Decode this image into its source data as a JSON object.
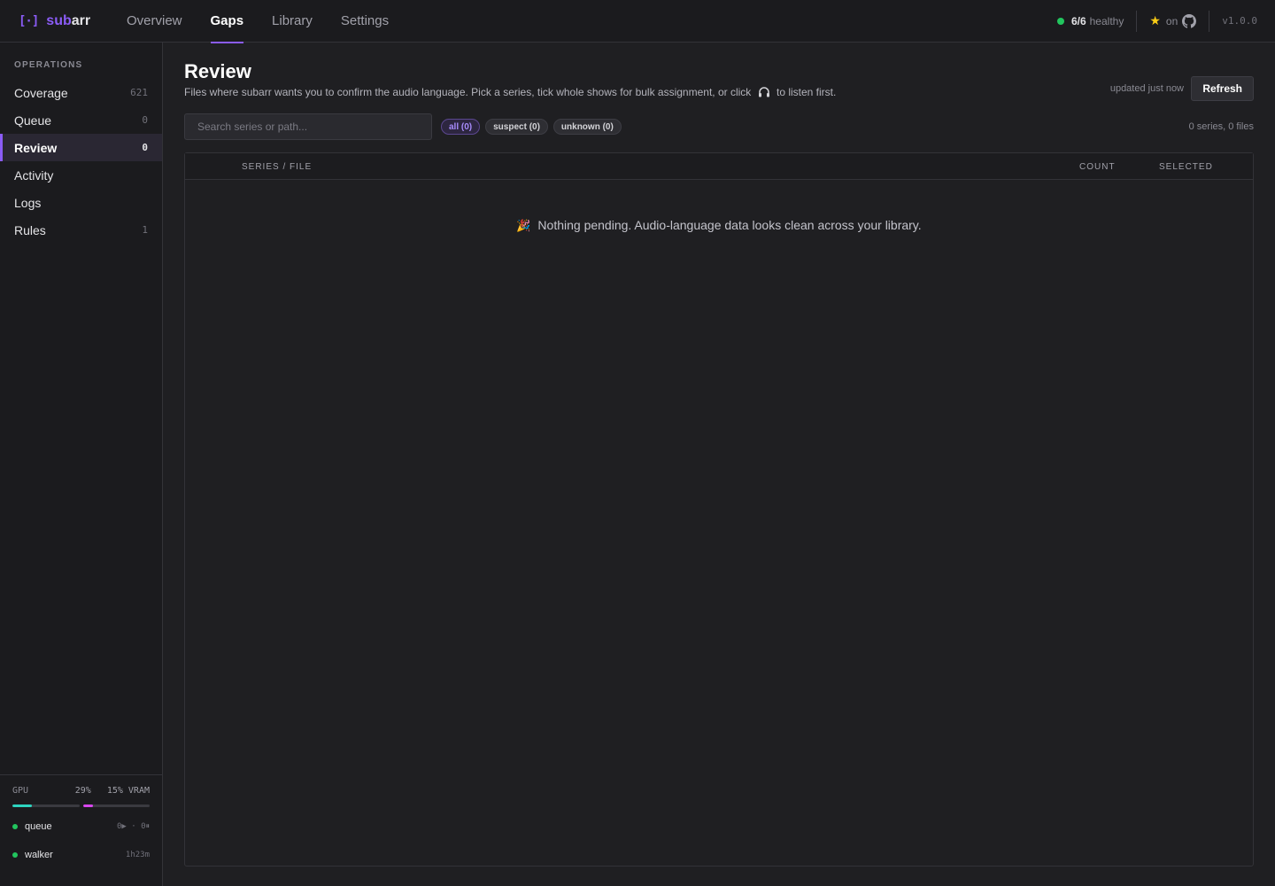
{
  "brand": {
    "icon": "[·]",
    "name_part1": "sub",
    "name_part2": "arr"
  },
  "nav": {
    "tabs": [
      {
        "label": "Overview"
      },
      {
        "label": "Gaps"
      },
      {
        "label": "Library"
      },
      {
        "label": "Settings"
      }
    ],
    "active": "Gaps"
  },
  "status": {
    "health_count": "6/6",
    "health_label": "healthy",
    "github_label": "on",
    "version": "v1.0.0",
    "health_color": "#22c55e"
  },
  "sidebar": {
    "heading": "OPERATIONS",
    "items": [
      {
        "label": "Coverage",
        "count": "621"
      },
      {
        "label": "Queue",
        "count": "0"
      },
      {
        "label": "Review",
        "count": "0",
        "active": true
      },
      {
        "label": "Activity",
        "count": ""
      },
      {
        "label": "Logs",
        "count": ""
      },
      {
        "label": "Rules",
        "count": "1"
      }
    ],
    "gpu": {
      "label": "GPU",
      "usage": "29%",
      "vram": "15% VRAM",
      "usage_fraction": 0.29,
      "vram_fraction": 0.15,
      "usage_color": "#2dd4bf",
      "vram_color": "#d946ef"
    },
    "workers": [
      {
        "name": "queue",
        "stat": "0▶ · 0⏸"
      },
      {
        "name": "walker",
        "stat": "1h23m"
      }
    ]
  },
  "page": {
    "title": "Review",
    "description_before": "Files where subarr wants you to confirm the audio language. Pick a series, tick whole shows for bulk assignment, or click",
    "description_after": "to listen first.",
    "updated": "updated just now",
    "refresh_label": "Refresh",
    "search_placeholder": "Search series or path...",
    "filters": [
      {
        "label": "all (0)",
        "active": true
      },
      {
        "label": "suspect (0)"
      },
      {
        "label": "unknown (0)"
      }
    ],
    "summary": "0 series, 0 files"
  },
  "table": {
    "columns": [
      "SERIES / FILE",
      "COUNT",
      "SELECTED"
    ],
    "empty_icon": "🎉",
    "empty_message": "Nothing pending. Audio-language data looks clean across your library."
  },
  "colors": {
    "accent": "#8b5cf6",
    "background": "#1f1f22",
    "panel": "#1b1b1e"
  }
}
